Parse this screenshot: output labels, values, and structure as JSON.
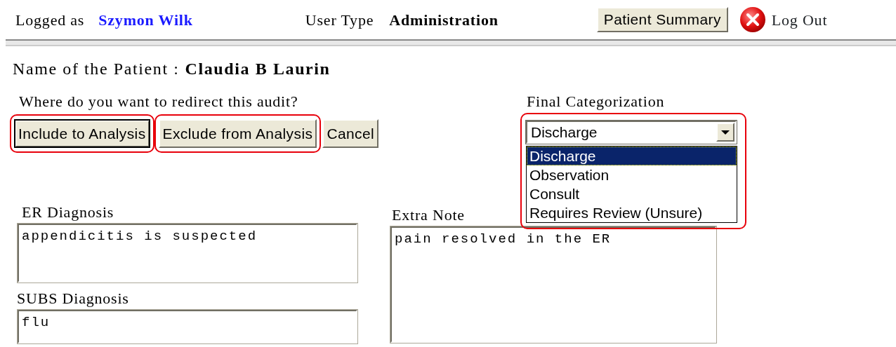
{
  "header": {
    "logged_as_label": "Logged as",
    "user_name": "Szymon Wilk",
    "user_type_label": "User Type",
    "user_type": "Administration",
    "summary_button": "Patient Summary",
    "logout": "Log Out"
  },
  "patient": {
    "label": "Name of the Patient :",
    "name": "Claudia B Laurin"
  },
  "redirect": {
    "question": "Where do you want to redirect this audit?",
    "buttons": [
      {
        "label": "Include to Analysis",
        "focused": true,
        "highlighted": true
      },
      {
        "label": "Exclude from Analysis",
        "focused": false,
        "highlighted": true
      },
      {
        "label": "Cancel",
        "focused": false,
        "highlighted": false
      }
    ]
  },
  "final_categorization": {
    "label": "Final Categorization",
    "value": "Discharge",
    "expanded": true,
    "highlighted": true,
    "options": [
      {
        "label": "Discharge",
        "selected": true
      },
      {
        "label": "Observation",
        "selected": false
      },
      {
        "label": "Consult",
        "selected": false
      },
      {
        "label": "Requires Review (Unsure)",
        "selected": false
      }
    ]
  },
  "diagnoses": [
    {
      "label": "ER Diagnosis",
      "value": "appendicitis is suspected"
    },
    {
      "label": "SUBS Diagnosis",
      "value": "flu"
    }
  ],
  "extra_note": {
    "label": "Extra Note",
    "value": "pain resolved in the ER"
  }
}
